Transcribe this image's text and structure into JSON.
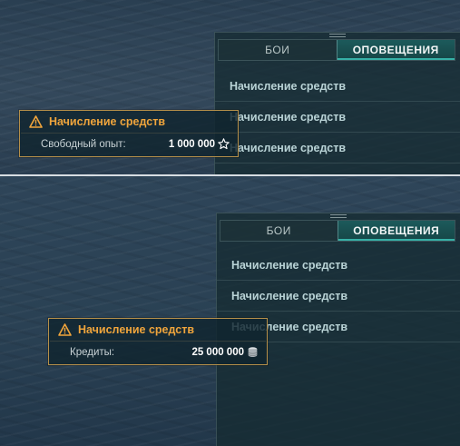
{
  "screens": [
    {
      "panel": {
        "tabs": [
          {
            "label": "БОИ",
            "active": false
          },
          {
            "label": "ОПОВЕЩЕНИЯ",
            "active": true
          }
        ],
        "items": [
          "Начисление средств",
          "Начисление средств",
          "Начисление средств"
        ]
      },
      "toast": {
        "title": "Начисление средств",
        "label": "Свободный опыт:",
        "value": "1 000 000",
        "icon": "star-icon"
      }
    },
    {
      "panel": {
        "tabs": [
          {
            "label": "БОИ",
            "active": false
          },
          {
            "label": "ОПОВЕЩЕНИЯ",
            "active": true
          }
        ],
        "items": [
          "Начисление средств",
          "Начисление средств",
          "Начисление средств"
        ]
      },
      "toast": {
        "title": "Начисление средств",
        "label": "Кредиты:",
        "value": "25 000 000",
        "icon": "credits-icon"
      }
    }
  ],
  "colors": {
    "accent_orange": "#f0a53c",
    "tab_active": "#1c5a5b",
    "item_text": "#b9d3d6"
  }
}
